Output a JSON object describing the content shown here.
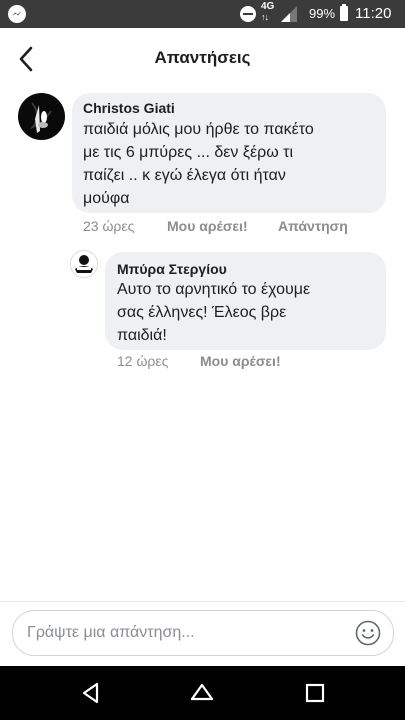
{
  "status_bar": {
    "network": "4G",
    "battery_percent": "99%",
    "time": "11:20"
  },
  "header": {
    "title": "Απαντήσεις"
  },
  "comments": [
    {
      "author": "Christos Giati",
      "lines": [
        "παιδιά μόλις μου ήρθε το πακέτο",
        "με τις 6 μπύρες ... δεν ξέρω τι",
        "παίζει .. κ εγώ έλεγα ότι ήταν",
        "μούφα"
      ],
      "time": "23 ώρες",
      "like_label": "Μου αρέσει!",
      "reply_label": "Απάντηση"
    },
    {
      "author": "Μπύρα Στεργίου",
      "lines": [
        "Αυτο το αρνητικό το έχουμε",
        "σας έλληνες! Έλεος βρε",
        "παιδιά!"
      ],
      "time": "12 ώρες",
      "like_label": "Μου αρέσει!"
    }
  ],
  "composer": {
    "placeholder": "Γράψτε μια απάντηση..."
  }
}
